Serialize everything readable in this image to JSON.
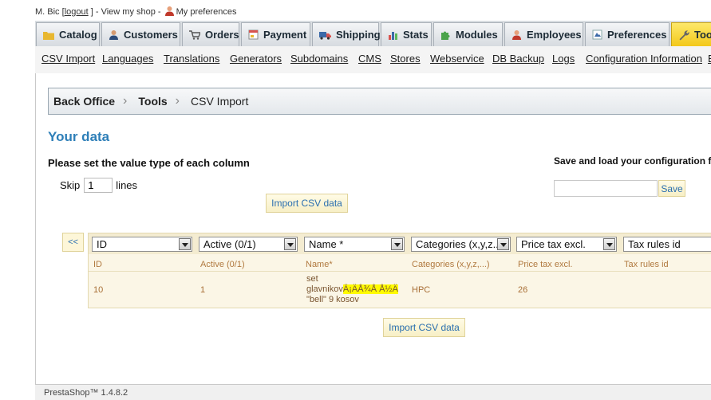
{
  "topbar": {
    "user": "M. Bic",
    "logout_open": "[",
    "logout": "logout",
    "logout_close": "] -",
    "view_shop": "View my shop -",
    "preferences": "My preferences"
  },
  "tabs": [
    "Catalog",
    "Customers",
    "Orders",
    "Payment",
    "Shipping",
    "Stats",
    "Modules",
    "Employees",
    "Preferences",
    "Tools"
  ],
  "subnav": [
    "CSV Import",
    "Languages",
    "Translations",
    "Generators",
    "Subdomains",
    "CMS",
    "Stores",
    "Webservice",
    "DB Backup",
    "Logs",
    "Configuration Information",
    "E"
  ],
  "breadcrumb": {
    "root": "Back Office",
    "section": "Tools",
    "page": "CSV Import"
  },
  "main": {
    "title": "Your data",
    "instruction": "Please set the value type of each column",
    "skip_label": "Skip",
    "skip_value": "1",
    "lines_label": "lines",
    "import_button": "Import CSV data",
    "prev_button": "<<"
  },
  "config": {
    "title": "Save and load your configuration fo",
    "input_value": "",
    "save_button": "Save"
  },
  "columns": [
    {
      "select": "ID",
      "header": "ID",
      "value": "10"
    },
    {
      "select": "Active (0/1)",
      "header": "Active (0/1)",
      "value": "1"
    },
    {
      "select": "Name *",
      "header": "Name*",
      "value": ""
    },
    {
      "select": "Categories (x,y,z...)",
      "header": "Categories (x,y,z,...)",
      "value": "HPC"
    },
    {
      "select": "Price tax excl.",
      "header": "Price tax excl.",
      "value": "26"
    },
    {
      "select": "Tax rules id",
      "header": "Tax rules id",
      "value": ""
    }
  ],
  "name_cell": {
    "line1": "set",
    "line2_a": "glavnikov",
    "line2_b": "Ä¡ÄÅ¾Å Å½Ä",
    "line3": "\"bell\" 9 kosov"
  },
  "footer": "PrestaShop™ 1.4.8.2"
}
